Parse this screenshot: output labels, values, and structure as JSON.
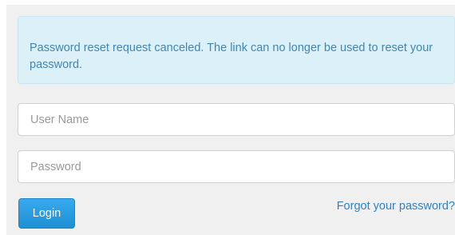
{
  "alert": {
    "message": "Password reset request canceled. The link can no longer be used to reset your password."
  },
  "form": {
    "username_placeholder": "User Name",
    "username_value": "",
    "password_placeholder": "Password",
    "password_value": "",
    "login_label": "Login",
    "forgot_label": "Forgot your password?"
  },
  "colors": {
    "alert_background": "#dcf0f8",
    "alert_text": "#3f86b3",
    "primary_button": "#2c9fe0",
    "link": "#2f82c0",
    "panel_background": "#f0f0f0"
  }
}
